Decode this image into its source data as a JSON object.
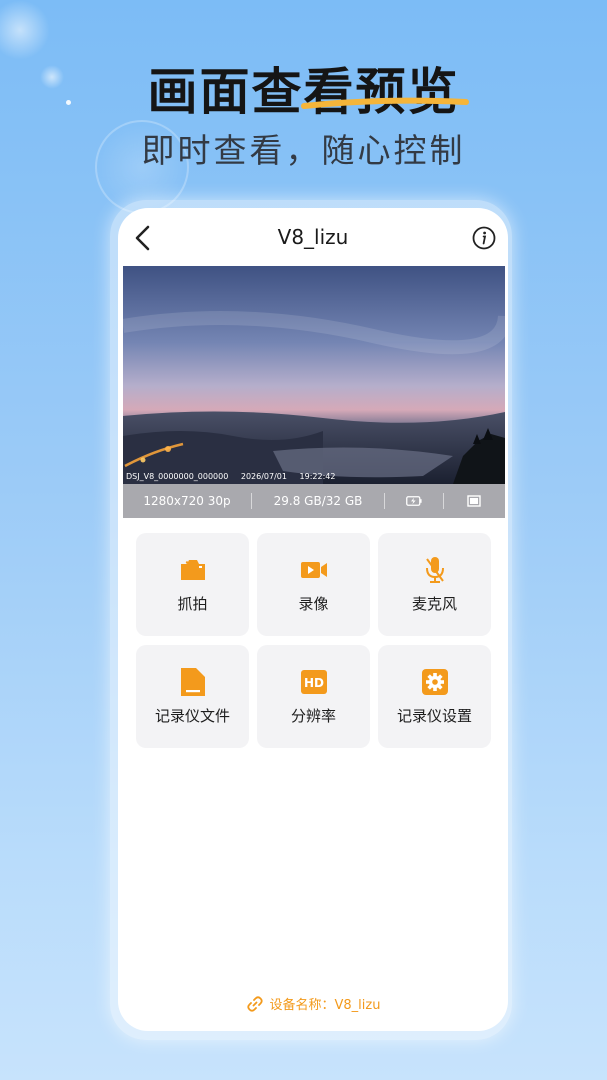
{
  "hero": {
    "title": "画面查看预览",
    "subtitle": "即时查看，随心控制"
  },
  "nav": {
    "title": "V8_lizu",
    "back_icon": "chevron-left-icon",
    "info_icon": "info-icon"
  },
  "video": {
    "file_name": "DSJ_V8_0000000_000000",
    "date": "2026/07/01",
    "time": "19:22:42"
  },
  "info_bar": {
    "resolution": "1280x720 30p",
    "storage": "29.8 GB/32 GB",
    "battery_icon": "battery-charging-icon",
    "fullscreen_icon": "fullscreen-icon"
  },
  "actions": [
    {
      "label": "抓拍",
      "icon": "camera-icon"
    },
    {
      "label": "录像",
      "icon": "video-camera-icon"
    },
    {
      "label": "麦克风",
      "icon": "microphone-icon"
    },
    {
      "label": "记录仪文件",
      "icon": "folder-icon"
    },
    {
      "label": "分辨率",
      "icon": "hd-icon"
    },
    {
      "label": "记录仪设置",
      "icon": "gear-icon"
    }
  ],
  "footer": {
    "device_name": "设备名称：V8_lizu"
  },
  "colors": {
    "accent": "#f39a1c",
    "background_top": "#7cbcf6",
    "background_bottom": "#c7e3fc",
    "tile_bg": "#f3f3f5",
    "info_bar": "#a9a9ae"
  }
}
